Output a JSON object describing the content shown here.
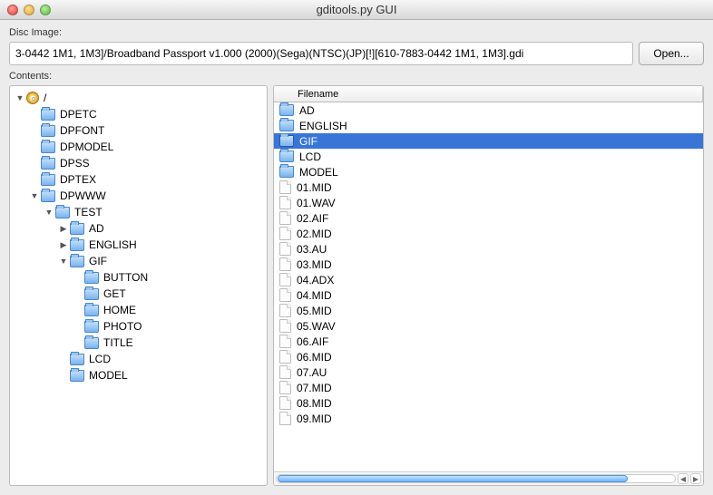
{
  "window": {
    "title": "gditools.py GUI"
  },
  "labels": {
    "disc_image": "Disc Image:",
    "contents": "Contents:",
    "open": "Open...",
    "filename": "Filename"
  },
  "disc_path": "3-0442 1M1, 1M3]/Broadband Passport v1.000 (2000)(Sega)(NTSC)(JP)[!][610-7883-0442 1M1, 1M3].gdi",
  "tree": {
    "root": {
      "label": "/",
      "expanded": true
    },
    "children": [
      {
        "label": "DPETC",
        "type": "folder"
      },
      {
        "label": "DPFONT",
        "type": "folder"
      },
      {
        "label": "DPMODEL",
        "type": "folder"
      },
      {
        "label": "DPSS",
        "type": "folder"
      },
      {
        "label": "DPTEX",
        "type": "folder"
      },
      {
        "label": "DPWWW",
        "type": "folder",
        "expanded": true,
        "children": [
          {
            "label": "TEST",
            "type": "folder",
            "expanded": true,
            "children": [
              {
                "label": "AD",
                "type": "folder",
                "hasChildren": true
              },
              {
                "label": "ENGLISH",
                "type": "folder",
                "hasChildren": true
              },
              {
                "label": "GIF",
                "type": "folder",
                "expanded": true,
                "children": [
                  {
                    "label": "BUTTON",
                    "type": "folder"
                  },
                  {
                    "label": "GET",
                    "type": "folder"
                  },
                  {
                    "label": "HOME",
                    "type": "folder"
                  },
                  {
                    "label": "PHOTO",
                    "type": "folder"
                  },
                  {
                    "label": "TITLE",
                    "type": "folder"
                  }
                ]
              },
              {
                "label": "LCD",
                "type": "folder"
              },
              {
                "label": "MODEL",
                "type": "folder"
              }
            ]
          }
        ]
      }
    ]
  },
  "list": [
    {
      "name": "AD",
      "type": "folder"
    },
    {
      "name": "ENGLISH",
      "type": "folder"
    },
    {
      "name": "GIF",
      "type": "folder",
      "selected": true
    },
    {
      "name": "LCD",
      "type": "folder"
    },
    {
      "name": "MODEL",
      "type": "folder"
    },
    {
      "name": "01.MID",
      "type": "file"
    },
    {
      "name": "01.WAV",
      "type": "file"
    },
    {
      "name": "02.AIF",
      "type": "file"
    },
    {
      "name": "02.MID",
      "type": "file"
    },
    {
      "name": "03.AU",
      "type": "file"
    },
    {
      "name": "03.MID",
      "type": "file"
    },
    {
      "name": "04.ADX",
      "type": "file"
    },
    {
      "name": "04.MID",
      "type": "file"
    },
    {
      "name": "05.MID",
      "type": "file"
    },
    {
      "name": "05.WAV",
      "type": "file"
    },
    {
      "name": "06.AIF",
      "type": "file"
    },
    {
      "name": "06.MID",
      "type": "file"
    },
    {
      "name": "07.AU",
      "type": "file"
    },
    {
      "name": "07.MID",
      "type": "file"
    },
    {
      "name": "08.MID",
      "type": "file"
    },
    {
      "name": "09.MID",
      "type": "file"
    }
  ]
}
